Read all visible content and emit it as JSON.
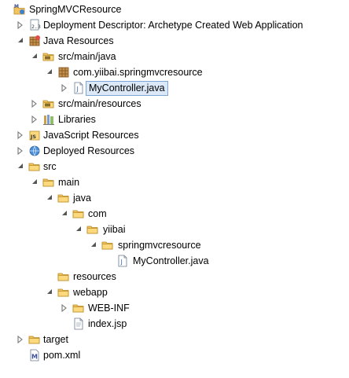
{
  "tree": {
    "project": "SpringMVCResource",
    "deployment_descriptor": "Deployment Descriptor: Archetype Created Web Application",
    "java_resources": "Java Resources",
    "src_main_java": "src/main/java",
    "package": "com.yiibai.springmvcresource",
    "controller_file_selected": "MyController.java",
    "src_main_resources": "src/main/resources",
    "libraries": "Libraries",
    "javascript_resources": "JavaScript Resources",
    "deployed_resources": "Deployed Resources",
    "src": "src",
    "main": "main",
    "java": "java",
    "com": "com",
    "yiibai": "yiibai",
    "springmvcresource": "springmvcresource",
    "controller_file": "MyController.java",
    "resources": "resources",
    "webapp": "webapp",
    "web_inf": "WEB-INF",
    "index_jsp": "index.jsp",
    "target": "target",
    "pom": "pom.xml"
  },
  "icons": {
    "project": "web-project-icon",
    "deployment": "deployment-descriptor-icon",
    "java_resources": "java-resources-icon",
    "source_folder": "source-folder-icon",
    "package": "package-icon",
    "java_file": "java-file-icon",
    "libraries": "libraries-icon",
    "js_resources": "javascript-resources-icon",
    "deployed": "deployed-resources-icon",
    "folder": "folder-icon",
    "jsp_file": "jsp-file-icon",
    "xml_file": "maven-pom-icon"
  },
  "colors": {
    "selection_bg": "#dbe8f7",
    "selection_border": "#7ea4d8",
    "folder_fill": "#f2c35f",
    "twisty": "#555555"
  }
}
